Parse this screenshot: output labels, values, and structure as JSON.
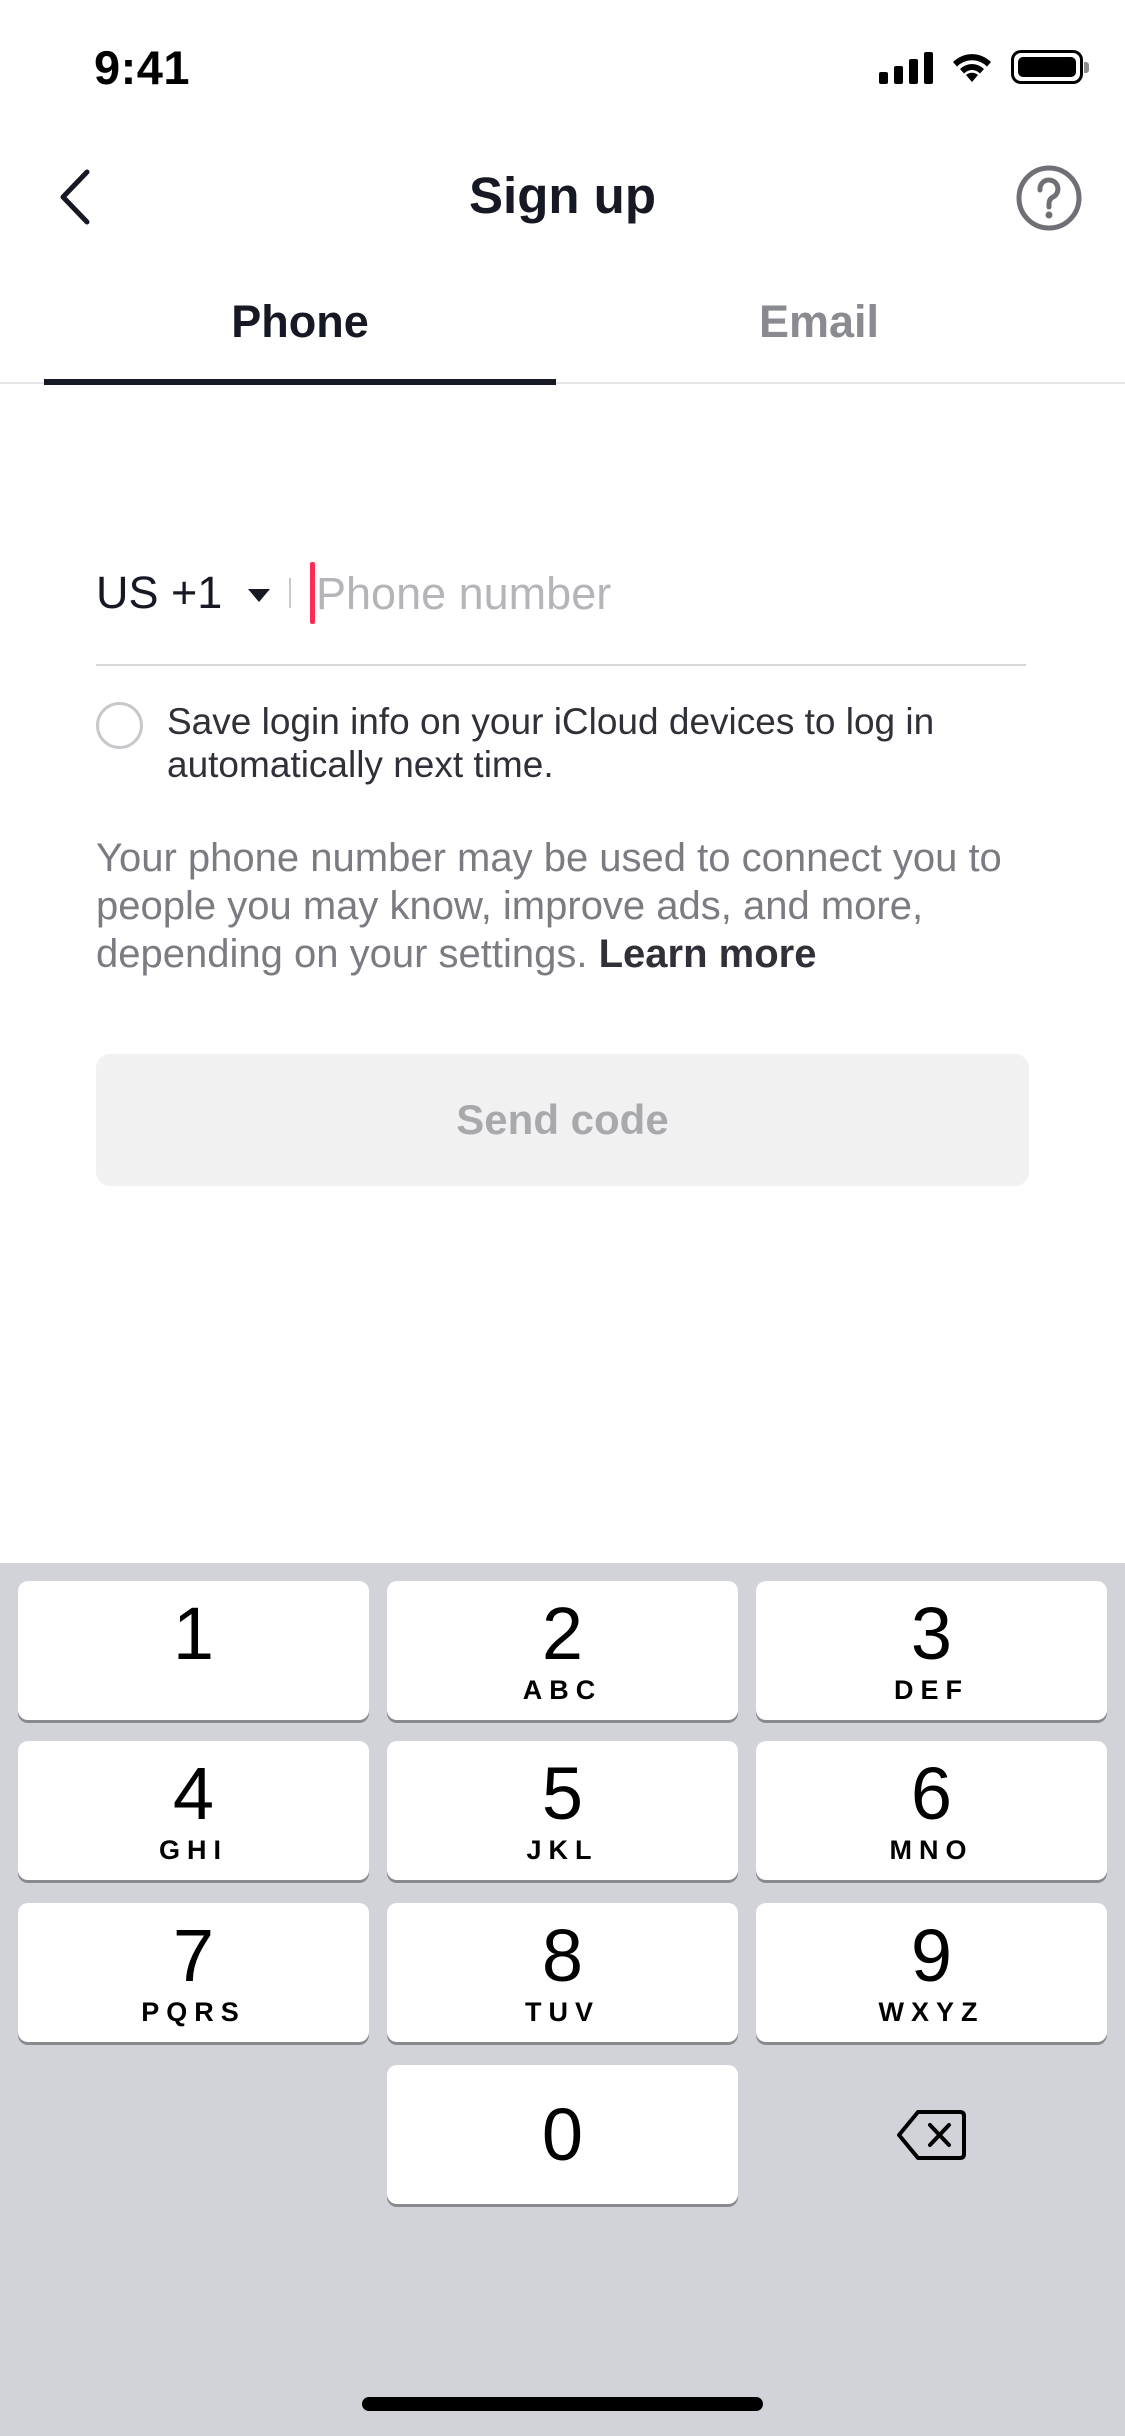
{
  "status_bar": {
    "time": "9:41"
  },
  "nav": {
    "title": "Sign up"
  },
  "tabs": [
    {
      "label": "Phone",
      "active": true
    },
    {
      "label": "Email",
      "active": false
    }
  ],
  "form": {
    "country_code": "US +1",
    "phone_placeholder": "Phone number",
    "phone_value": "",
    "save_login_label": "Save login info on your iCloud devices to log in automatically next time.",
    "save_login_checked": false,
    "info_text": "Your phone number may be used to connect you to people you may know, improve ads, and more, depending on your settings.",
    "learn_more": "Learn more",
    "send_code_label": "Send code",
    "send_code_enabled": false
  },
  "keyboard": {
    "keys": [
      {
        "digit": "1",
        "letters": ""
      },
      {
        "digit": "2",
        "letters": "ABC"
      },
      {
        "digit": "3",
        "letters": "DEF"
      },
      {
        "digit": "4",
        "letters": "GHI"
      },
      {
        "digit": "5",
        "letters": "JKL"
      },
      {
        "digit": "6",
        "letters": "MNO"
      },
      {
        "digit": "7",
        "letters": "PQRS"
      },
      {
        "digit": "8",
        "letters": "TUV"
      },
      {
        "digit": "9",
        "letters": "WXYZ"
      },
      {
        "digit": "0",
        "letters": ""
      }
    ],
    "delete_icon": "delete-backspace-icon"
  },
  "colors": {
    "accent_cursor": "#fe2c55",
    "text_primary": "#161823",
    "tab_inactive": "#8a8b91",
    "keyboard_bg": "#d1d3d9"
  }
}
